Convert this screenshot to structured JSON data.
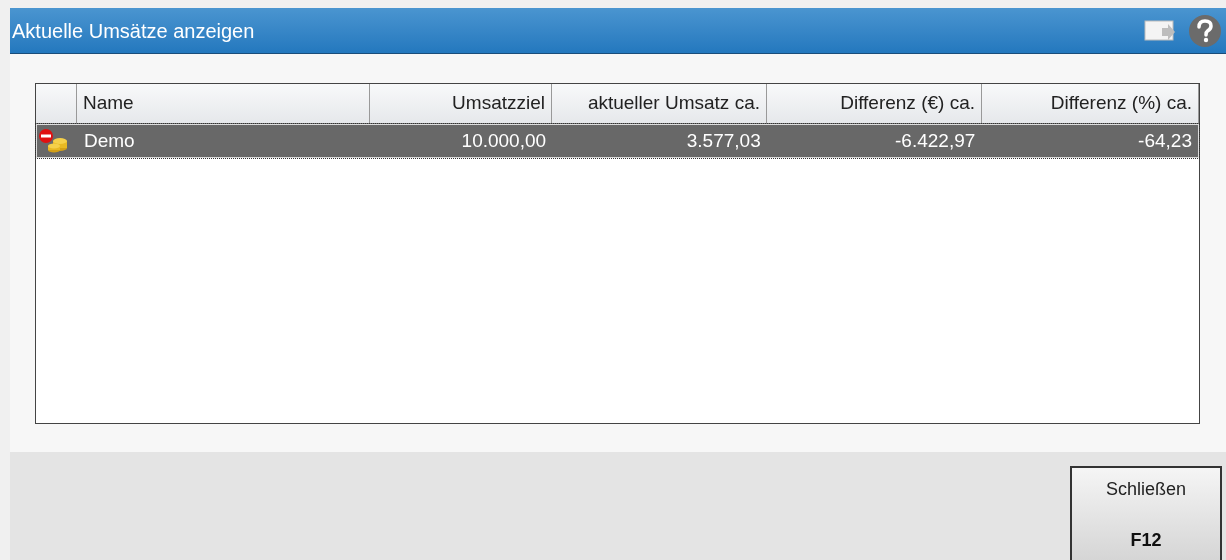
{
  "window": {
    "title": "Aktuelle Umsätze anzeigen"
  },
  "table": {
    "columns": [
      "Name",
      "Umsatzziel",
      "aktueller Umsatz ca.",
      "Differenz (€) ca.",
      "Differenz (%) ca."
    ],
    "rows": [
      {
        "selected": true,
        "cells": [
          "Demo",
          "10.000,00",
          "3.577,03",
          "-6.422,97",
          "-64,23"
        ]
      }
    ]
  },
  "buttons": [
    {
      "label": "Schließen",
      "key": "F12"
    }
  ]
}
